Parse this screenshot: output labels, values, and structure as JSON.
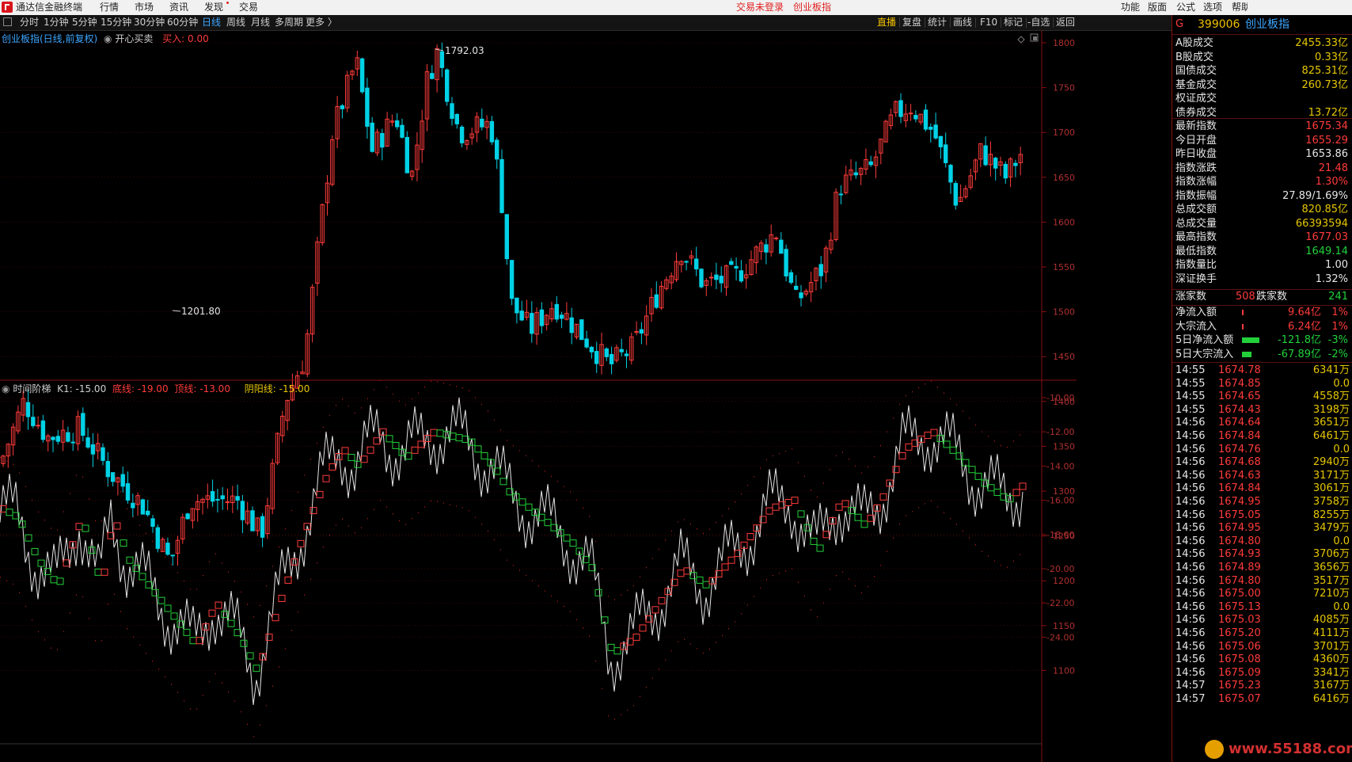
{
  "menubar": {
    "app_title": "通达信金融终端",
    "menus": [
      "行情",
      "市场",
      "资讯",
      "发现",
      "交易"
    ],
    "status_trade": "交易未登录",
    "status_index": "创业板指",
    "right_menus": [
      "功能",
      "版面",
      "公式",
      "选项",
      "帮助"
    ]
  },
  "toolbar": {
    "periods": [
      "分时",
      "1分钟",
      "5分钟",
      "15分钟",
      "30分钟",
      "60分钟",
      "日线",
      "周线",
      "月线",
      "多周期",
      "更多 〉"
    ],
    "active": "日线",
    "right_tools": [
      "直播",
      "复盘",
      "统计",
      "画线",
      "F10",
      "标记",
      "-自选",
      "返回"
    ]
  },
  "main_chart": {
    "title": "创业板指(日线,前复权)",
    "indicator": "开心买卖",
    "buy_label": "买入: 0.00",
    "high_marker": "1792.03",
    "low_marker": "1201.80",
    "y_ticks": [
      "1800",
      "1750",
      "1700",
      "1650",
      "1600",
      "1550",
      "1500",
      "1450",
      "1400",
      "1350",
      "1300",
      "1250",
      "1200",
      "1150",
      "1100"
    ]
  },
  "sub_chart": {
    "title": "时间阶梯",
    "k1": "K1: -15.00",
    "bottom_line": "底线: -19.00",
    "top_line": "顶线: -13.00",
    "yinyang": "阴阳线: -15.00",
    "y_ticks": [
      "-10.00",
      "-12.00",
      "-14.00",
      "-16.00",
      "-18.00",
      "-20.00",
      "-22.00",
      "-24.00"
    ]
  },
  "quote_panel": {
    "marker": "G",
    "code": "399006",
    "name": "创业板指",
    "rows": [
      {
        "label": "A股成交",
        "value": "2455.33亿",
        "cls": "yel"
      },
      {
        "label": "B股成交",
        "value": "0.33亿",
        "cls": "yel"
      },
      {
        "label": "国债成交",
        "value": "825.31亿",
        "cls": "yel"
      },
      {
        "label": "基金成交",
        "value": "260.73亿",
        "cls": "yel"
      },
      {
        "label": "权证成交",
        "value": "",
        "cls": "yel"
      },
      {
        "label": "债券成交",
        "value": "13.72亿",
        "cls": "yel"
      },
      {
        "label": "最新指数",
        "value": "1675.34",
        "cls": "up"
      },
      {
        "label": "今日开盘",
        "value": "1655.29",
        "cls": "up"
      },
      {
        "label": "昨日收盘",
        "value": "1653.86",
        "cls": "wht"
      },
      {
        "label": "指数涨跌",
        "value": "21.48",
        "cls": "up"
      },
      {
        "label": "指数涨幅",
        "value": "1.30%",
        "cls": "up"
      },
      {
        "label": "指数振幅",
        "value": "27.89/1.69%",
        "cls": "wht"
      },
      {
        "label": "总成交额",
        "value": "820.85亿",
        "cls": "yel"
      },
      {
        "label": "总成交量",
        "value": "66393594",
        "cls": "yel"
      },
      {
        "label": "最高指数",
        "value": "1677.03",
        "cls": "up"
      },
      {
        "label": "最低指数",
        "value": "1649.14",
        "cls": "dn"
      },
      {
        "label": "指数量比",
        "value": "1.00",
        "cls": "wht"
      },
      {
        "label": "深证换手",
        "value": "1.32%",
        "cls": "wht"
      }
    ],
    "rise_label": "涨家数",
    "rise_value": "508",
    "fall_label": "跌家数",
    "fall_value": "241",
    "flows": [
      {
        "label": "净流入额",
        "value": "9.64亿",
        "pct": "1%",
        "cls": "up"
      },
      {
        "label": "大宗流入",
        "value": "6.24亿",
        "pct": "1%",
        "cls": "up"
      },
      {
        "label": "5日净流入额",
        "value": "-121.8亿",
        "pct": "-3%",
        "cls": "dn"
      },
      {
        "label": "5日大宗流入",
        "value": "-67.89亿",
        "pct": "-2%",
        "cls": "dn"
      }
    ],
    "ticks": [
      {
        "t": "14:55",
        "p": "1674.78",
        "v": "6341万",
        "c": "up"
      },
      {
        "t": "14:55",
        "p": "1674.85",
        "v": "0.0",
        "c": "up"
      },
      {
        "t": "14:55",
        "p": "1674.65",
        "v": "4558万",
        "c": "up"
      },
      {
        "t": "14:55",
        "p": "1674.43",
        "v": "3198万",
        "c": "up"
      },
      {
        "t": "14:56",
        "p": "1674.64",
        "v": "3651万",
        "c": "up"
      },
      {
        "t": "14:56",
        "p": "1674.84",
        "v": "6461万",
        "c": "up"
      },
      {
        "t": "14:56",
        "p": "1674.76",
        "v": "0.0",
        "c": "up"
      },
      {
        "t": "14:56",
        "p": "1674.68",
        "v": "2940万",
        "c": "up"
      },
      {
        "t": "14:56",
        "p": "1674.63",
        "v": "3171万",
        "c": "up"
      },
      {
        "t": "14:56",
        "p": "1674.84",
        "v": "3061万",
        "c": "up"
      },
      {
        "t": "14:56",
        "p": "1674.95",
        "v": "3758万",
        "c": "up"
      },
      {
        "t": "14:56",
        "p": "1675.05",
        "v": "8255万",
        "c": "up"
      },
      {
        "t": "14:56",
        "p": "1674.95",
        "v": "3479万",
        "c": "up"
      },
      {
        "t": "14:56",
        "p": "1674.80",
        "v": "0.0",
        "c": "up"
      },
      {
        "t": "14:56",
        "p": "1674.93",
        "v": "3706万",
        "c": "up"
      },
      {
        "t": "14:56",
        "p": "1674.89",
        "v": "3656万",
        "c": "up"
      },
      {
        "t": "14:56",
        "p": "1674.80",
        "v": "3517万",
        "c": "up"
      },
      {
        "t": "14:56",
        "p": "1675.00",
        "v": "7210万",
        "c": "up"
      },
      {
        "t": "14:56",
        "p": "1675.13",
        "v": "0.0",
        "c": "up"
      },
      {
        "t": "14:56",
        "p": "1675.03",
        "v": "4085万",
        "c": "up"
      },
      {
        "t": "14:56",
        "p": "1675.20",
        "v": "4111万",
        "c": "up"
      },
      {
        "t": "14:56",
        "p": "1675.06",
        "v": "3701万",
        "c": "up"
      },
      {
        "t": "14:56",
        "p": "1675.08",
        "v": "4360万",
        "c": "up"
      },
      {
        "t": "14:56",
        "p": "1675.09",
        "v": "3341万",
        "c": "up"
      },
      {
        "t": "14:57",
        "p": "1675.23",
        "v": "3167万",
        "c": "up"
      },
      {
        "t": "14:57",
        "p": "1675.07",
        "v": "6416万",
        "c": "up"
      }
    ]
  },
  "watermark": "www.55188.com",
  "colors": {
    "up": "#ff3b3b",
    "down": "#22d13a",
    "white": "#e6e6e6",
    "accent": "#3ca6ff",
    "bg": "#000000"
  }
}
